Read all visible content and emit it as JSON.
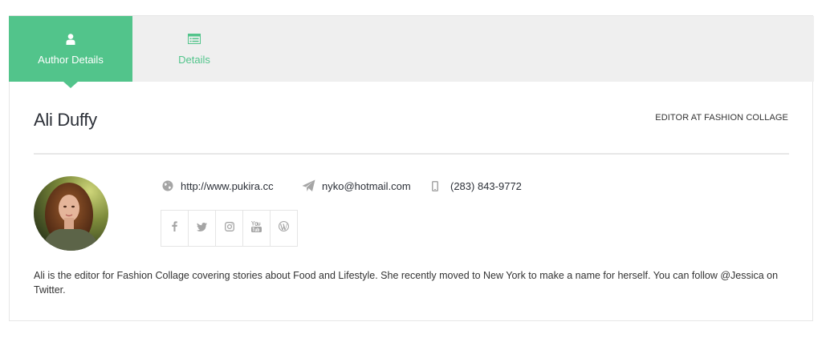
{
  "tabs": [
    {
      "label": "Author Details",
      "icon": "user-icon",
      "active": true
    },
    {
      "label": "Details",
      "icon": "list-icon",
      "active": false
    }
  ],
  "author": {
    "name": "Ali Duffy",
    "role": "EDITOR AT FASHION COLLAGE",
    "website": "http://www.pukira.cc",
    "email": "nyko@hotmail.com",
    "phone": "(283) 843-9772",
    "bio": "Ali is the editor for Fashion Collage covering stories about Food and Lifestyle. She recently moved to New York to make a name for herself. You can follow @Jessica on Twitter."
  },
  "socials": [
    {
      "icon": "facebook-icon"
    },
    {
      "icon": "twitter-icon"
    },
    {
      "icon": "instagram-icon"
    },
    {
      "icon": "youtube-icon"
    },
    {
      "icon": "wordpress-icon"
    }
  ],
  "colors": {
    "accent": "#52c48b",
    "tab_bar": "#efefef",
    "icon_gray": "#a5a5a5",
    "text_dark": "#2c3038"
  }
}
